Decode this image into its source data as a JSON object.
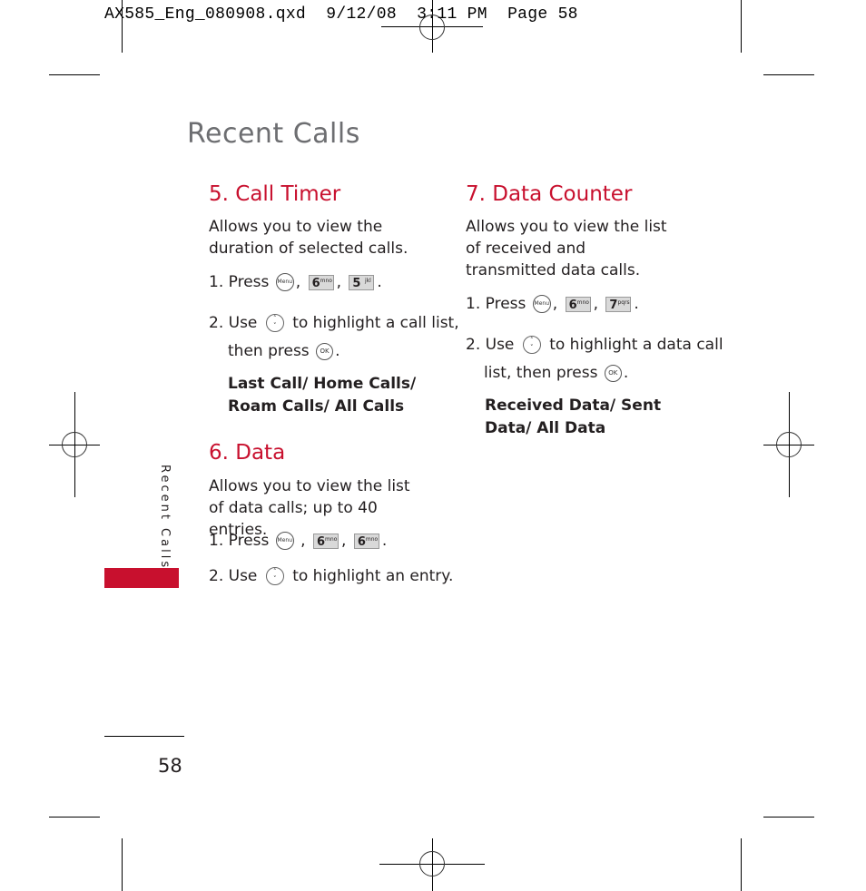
{
  "slug": "AX585_Eng_080908.qxd  9/12/08  3:11 PM  Page 58",
  "page_title": "Recent Calls",
  "side_tab": "Recent Calls",
  "page_number": "58",
  "colors": {
    "accent": "#c8102e",
    "title_gray": "#6d6e71"
  },
  "sections": {
    "call_timer": {
      "heading": "5. Call Timer",
      "desc": "Allows you to view the duration of selected calls.",
      "step1_prefix": "1. Press",
      "step1_keys": [
        {
          "icon": "menu-key",
          "label": "Menu"
        },
        {
          "icon": "key-6",
          "num": "6",
          "letters": "mno"
        },
        {
          "icon": "key-5",
          "num": "5",
          "letters": "jkl"
        }
      ],
      "step2_prefix": "2. Use",
      "step2_text": "to highlight a call list,",
      "step2_line2": "then press",
      "ok_label": "OK",
      "options": "Last Call/ Home Calls/ Roam Calls/ All Calls"
    },
    "data": {
      "heading": "6. Data",
      "desc": "Allows you to view the list of data calls; up to 40 entries.",
      "step1_prefix": "1. Press",
      "step1_keys": [
        {
          "icon": "menu-key",
          "label": "Menu"
        },
        {
          "icon": "key-6",
          "num": "6",
          "letters": "mno"
        },
        {
          "icon": "key-6",
          "num": "6",
          "letters": "mno"
        }
      ],
      "step2_prefix": "2. Use",
      "step2_text": "to highlight an entry."
    },
    "data_counter": {
      "heading": "7. Data Counter",
      "desc": "Allows you to view the list of received and transmitted data calls.",
      "step1_prefix": "1. Press",
      "step1_keys": [
        {
          "icon": "menu-key",
          "label": "Menu"
        },
        {
          "icon": "key-6",
          "num": "6",
          "letters": "mno"
        },
        {
          "icon": "key-7",
          "num": "7",
          "letters": "pqrs"
        }
      ],
      "step2_prefix": "2. Use",
      "step2_text": "to highlight a data call",
      "step2_line2": "list, then press",
      "ok_label": "OK",
      "options": "Received Data/ Sent Data/ All Data"
    }
  }
}
